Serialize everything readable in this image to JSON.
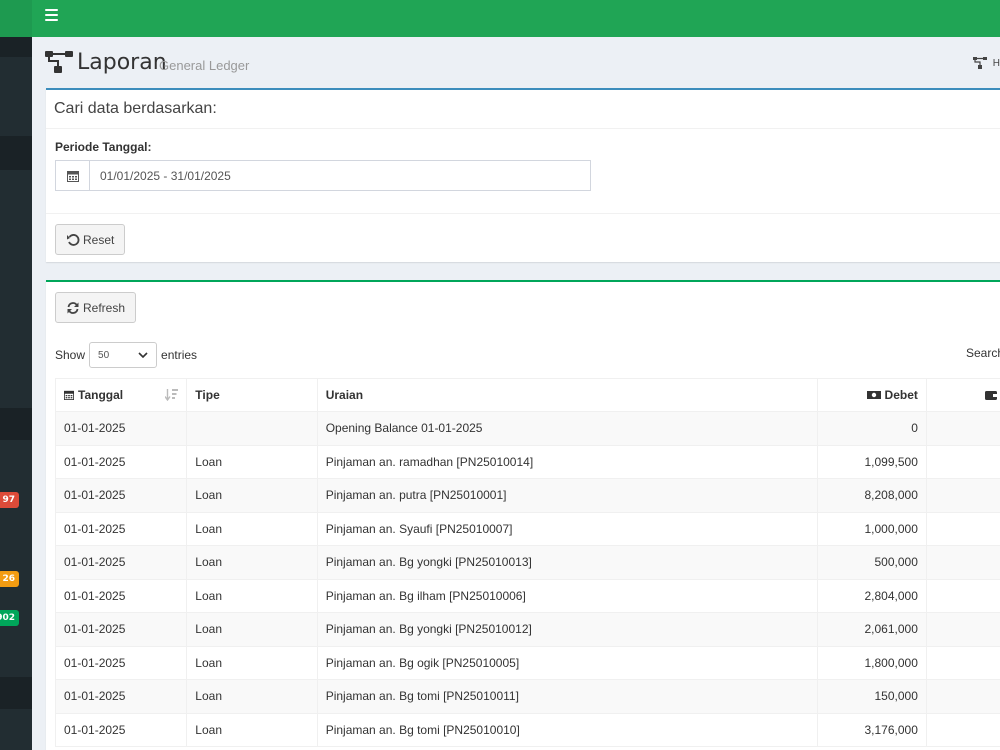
{
  "sidebar": {
    "badges": [
      {
        "text": "97",
        "color": "#dd4b39"
      },
      {
        "text": "26",
        "color": "#f39c12"
      },
      {
        "text": "902",
        "color": "#00a65a"
      }
    ]
  },
  "header": {
    "title": "Laporan",
    "subtitle": "General Ledger",
    "breadcrumb_home": "H"
  },
  "filter": {
    "title": "Cari data berdasarkan:",
    "period_label": "Periode Tanggal:",
    "period_value": "01/01/2025 - 31/01/2025",
    "reset_label": "Reset"
  },
  "table_box": {
    "refresh_label": "Refresh",
    "show_label": "Show",
    "entries_value": "50",
    "entries_label": "entries",
    "search_label": "Search"
  },
  "table": {
    "columns": [
      "Tanggal",
      "Tipe",
      "Uraian",
      "Debet"
    ],
    "rows": [
      [
        "01-01-2025",
        "",
        "Opening Balance 01-01-2025",
        "0"
      ],
      [
        "01-01-2025",
        "Loan",
        "Pinjaman an. ramadhan [PN25010014]",
        "1,099,500"
      ],
      [
        "01-01-2025",
        "Loan",
        "Pinjaman an. putra [PN25010001]",
        "8,208,000"
      ],
      [
        "01-01-2025",
        "Loan",
        "Pinjaman an. Syaufi [PN25010007]",
        "1,000,000"
      ],
      [
        "01-01-2025",
        "Loan",
        "Pinjaman an. Bg yongki [PN25010013]",
        "500,000"
      ],
      [
        "01-01-2025",
        "Loan",
        "Pinjaman an. Bg ilham [PN25010006]",
        "2,804,000"
      ],
      [
        "01-01-2025",
        "Loan",
        "Pinjaman an. Bg yongki [PN25010012]",
        "2,061,000"
      ],
      [
        "01-01-2025",
        "Loan",
        "Pinjaman an. Bg ogik [PN25010005]",
        "1,800,000"
      ],
      [
        "01-01-2025",
        "Loan",
        "Pinjaman an. Bg tomi [PN25010011]",
        "150,000"
      ],
      [
        "01-01-2025",
        "Loan",
        "Pinjaman an. Bg tomi [PN25010010]",
        "3,176,000"
      ]
    ]
  },
  "colors": {
    "topbar": "#20a555",
    "sidebar": "#222d32",
    "filter_border": "#3c8dbc",
    "table_border": "#00a65a"
  }
}
